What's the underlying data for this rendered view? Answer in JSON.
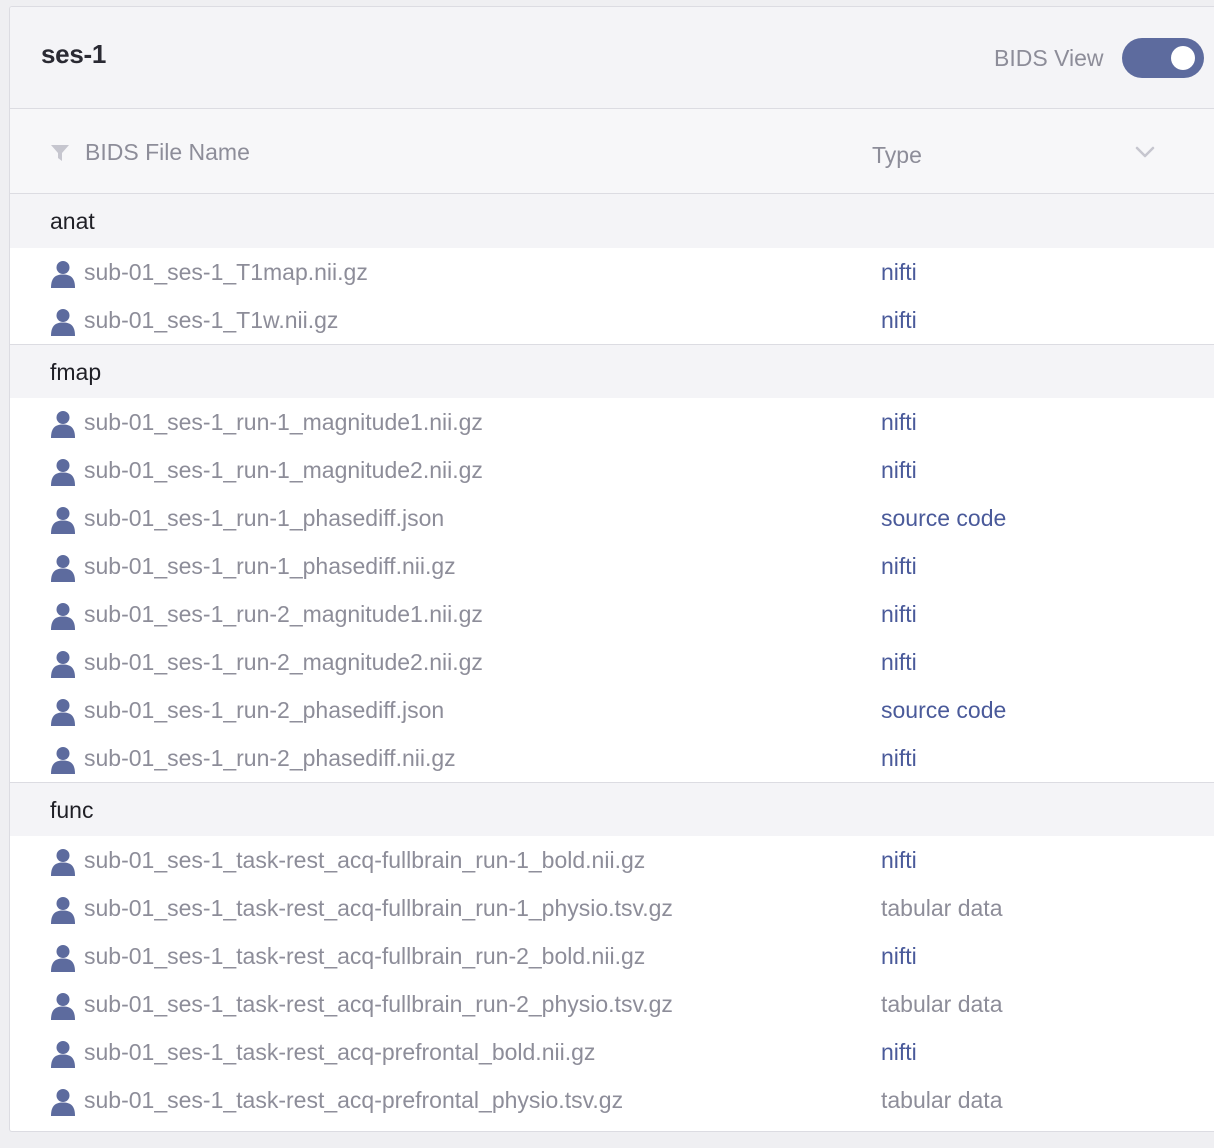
{
  "header": {
    "title": "ses-1",
    "bids_view_label": "BIDS View",
    "bids_view_on": true
  },
  "columns": {
    "name": "BIDS File Name",
    "type": "Type"
  },
  "colors": {
    "toggle": "#5d6b9e",
    "type_link": "#4a5a9a",
    "type_plain": "#8d8d99",
    "file_icon": "#5d6b9e"
  },
  "groups": [
    {
      "label": "anat",
      "files": [
        {
          "name": "sub-01_ses-1_T1map.nii.gz",
          "type": "nifti"
        },
        {
          "name": "sub-01_ses-1_T1w.nii.gz",
          "type": "nifti"
        }
      ]
    },
    {
      "label": "fmap",
      "files": [
        {
          "name": "sub-01_ses-1_run-1_magnitude1.nii.gz",
          "type": "nifti"
        },
        {
          "name": "sub-01_ses-1_run-1_magnitude2.nii.gz",
          "type": "nifti"
        },
        {
          "name": "sub-01_ses-1_run-1_phasediff.json",
          "type": "source code"
        },
        {
          "name": "sub-01_ses-1_run-1_phasediff.nii.gz",
          "type": "nifti"
        },
        {
          "name": "sub-01_ses-1_run-2_magnitude1.nii.gz",
          "type": "nifti"
        },
        {
          "name": "sub-01_ses-1_run-2_magnitude2.nii.gz",
          "type": "nifti"
        },
        {
          "name": "sub-01_ses-1_run-2_phasediff.json",
          "type": "source code"
        },
        {
          "name": "sub-01_ses-1_run-2_phasediff.nii.gz",
          "type": "nifti"
        }
      ]
    },
    {
      "label": "func",
      "files": [
        {
          "name": "sub-01_ses-1_task-rest_acq-fullbrain_run-1_bold.nii.gz",
          "type": "nifti"
        },
        {
          "name": "sub-01_ses-1_task-rest_acq-fullbrain_run-1_physio.tsv.gz",
          "type": "tabular data"
        },
        {
          "name": "sub-01_ses-1_task-rest_acq-fullbrain_run-2_bold.nii.gz",
          "type": "nifti"
        },
        {
          "name": "sub-01_ses-1_task-rest_acq-fullbrain_run-2_physio.tsv.gz",
          "type": "tabular data"
        },
        {
          "name": "sub-01_ses-1_task-rest_acq-prefrontal_bold.nii.gz",
          "type": "nifti"
        },
        {
          "name": "sub-01_ses-1_task-rest_acq-prefrontal_physio.tsv.gz",
          "type": "tabular data"
        }
      ]
    }
  ]
}
